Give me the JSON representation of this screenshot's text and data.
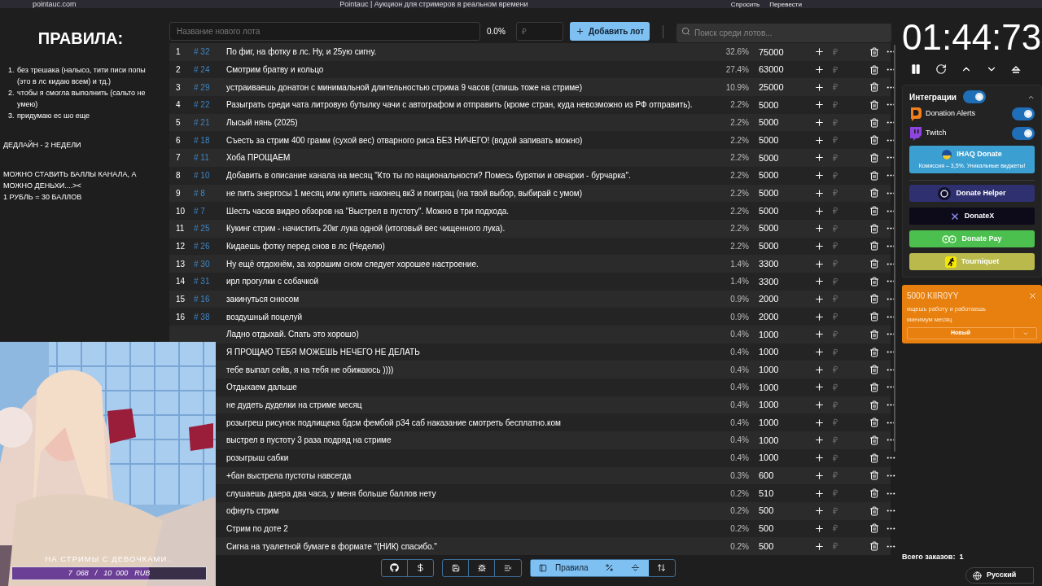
{
  "browser": {
    "url": "pointauc.com",
    "title": "Pointauc | Аукцион для стримеров в реальном времени",
    "actions": [
      "Спросить",
      "Перевести"
    ]
  },
  "rules": {
    "title": "ПРАВИЛА:",
    "items": [
      {
        "number": "1.",
        "text": "без трешака (налысо, тити писи попы (это в лс кидаю всем) и тд.)"
      },
      {
        "number": "2.",
        "text": "чтобы я смогла выполнить (сальто не умею)"
      },
      {
        "number": "3.",
        "text": "придумаю ес шо еще"
      }
    ],
    "notes": [
      "ДЕДЛАЙН - 2 НЕДЕЛИ",
      "МОЖНО СТАВИТЬ БАЛЛЫ КАНАЛА, А МОЖНО ДЕНЬХИ....><\n1 РУБЛЬ = 30 БАЛЛОВ"
    ]
  },
  "new_lot": {
    "placeholder": "Название нового лота",
    "percent": "0.0%",
    "amount_placeholder": "₽",
    "add_button": "Добавить лот"
  },
  "search": {
    "placeholder": "Поиск среди лотов..."
  },
  "lots": [
    {
      "number": "1",
      "id": "# 32",
      "text": "По фиг, на фотку в лс. Ну, и 25ую сигну.",
      "percent": "32.6%",
      "amount": "75000"
    },
    {
      "number": "2",
      "id": "# 24",
      "text": "Смотрим братву и кольцо",
      "percent": "27.4%",
      "amount": "63000"
    },
    {
      "number": "3",
      "id": "# 29",
      "text": "устраиваешь донатон с минимальной длительностью стрима 9 часов (спишь тоже на стриме)",
      "percent": "10.9%",
      "amount": "25000"
    },
    {
      "number": "4",
      "id": "# 22",
      "text": "Разыграть среди чата литровую бутылку чачи с автографом и отправить (кроме стран, куда невозможно из РФ отправить).",
      "percent": "2.2%",
      "amount": "5000"
    },
    {
      "number": "5",
      "id": "# 21",
      "text": "Лысый нянь (2025)",
      "percent": "2.2%",
      "amount": "5000"
    },
    {
      "number": "6",
      "id": "# 18",
      "text": "Съесть за стрим 400 грамм (сухой вес) отварного риса БЕЗ НИЧЕГО! (водой запивать можно)",
      "percent": "2.2%",
      "amount": "5000"
    },
    {
      "number": "7",
      "id": "# 11",
      "text": "Хоба ПРОЩАЕМ",
      "percent": "2.2%",
      "amount": "5000"
    },
    {
      "number": "8",
      "id": "# 10",
      "text": "Добавить в описание канала на месяц \"Кто ты по национальности? Помесь бурятки и овчарки - бурчарка\".",
      "percent": "2.2%",
      "amount": "5000"
    },
    {
      "number": "9",
      "id": "# 8",
      "text": "не пить энергосы 1 месяц или купить наконец вк3 и поиграц (на твой выбор, выбирай с умом)",
      "percent": "2.2%",
      "amount": "5000"
    },
    {
      "number": "10",
      "id": "# 7",
      "text": "Шесть часов видео обзоров на \"Выстрел в пустоту\". Можно в три подхода.",
      "percent": "2.2%",
      "amount": "5000"
    },
    {
      "number": "11",
      "id": "# 25",
      "text": "Кукинг стрим - начистить 20кг лука одной (итоговый вес чищенного лука).",
      "percent": "2.2%",
      "amount": "5000"
    },
    {
      "number": "12",
      "id": "# 26",
      "text": "Кидаешь фотку перед снов в лс (Неделю)",
      "percent": "2.2%",
      "amount": "5000"
    },
    {
      "number": "13",
      "id": "# 30",
      "text": "Ну ещё отдохнём, за хорошим сном следует хорошее настроение.",
      "percent": "1.4%",
      "amount": "3300"
    },
    {
      "number": "14",
      "id": "# 31",
      "text": "ирл прогулки с собачкой",
      "percent": "1.4%",
      "amount": "3300"
    },
    {
      "number": "15",
      "id": "# 16",
      "text": "закинуться снюсом",
      "percent": "0.9%",
      "amount": "2000"
    },
    {
      "number": "16",
      "id": "# 38",
      "text": "воздушный поцелуй",
      "percent": "0.9%",
      "amount": "2000"
    },
    {
      "text": "Ладно отдыхай. Спать это хорошо)",
      "percent": "0.4%",
      "amount": "1000"
    },
    {
      "text": "Я ПРОЩАЮ ТЕБЯ МОЖЕШЬ НЕЧЕГО НЕ ДЕЛАТЬ",
      "percent": "0.4%",
      "amount": "1000"
    },
    {
      "text": "тебе выпал сейв, я на тебя не обижаюсь ))))",
      "percent": "0.4%",
      "amount": "1000"
    },
    {
      "text": "Отдыхаем дальше",
      "percent": "0.4%",
      "amount": "1000"
    },
    {
      "text": "не дудеть дуделки на стриме месяц",
      "percent": "0.4%",
      "amount": "1000"
    },
    {
      "text": "розыгреш рисунок подлищека бдсм фембой р34 саб наказание смотреть бесплатно.ком",
      "percent": "0.4%",
      "amount": "1000"
    },
    {
      "text": "выстрел в пустоту 3 раза подряд на стриме",
      "percent": "0.4%",
      "amount": "1000"
    },
    {
      "text": "розыгрыш сабки",
      "percent": "0.4%",
      "amount": "1000"
    },
    {
      "text": "+бан выстрела пустоты навсегда",
      "percent": "0.3%",
      "amount": "600"
    },
    {
      "text": "слушаешь даера два часа, у меня больше баллов нету",
      "percent": "0.2%",
      "amount": "510"
    },
    {
      "text": "офнуть стрим",
      "percent": "0.2%",
      "amount": "500"
    },
    {
      "text": "Стрим по доте 2",
      "percent": "0.2%",
      "amount": "500"
    },
    {
      "text": "Сигна на туалетной бумаге в формате \"(НИК) спасибо.\"",
      "percent": "0.2%",
      "amount": "500"
    }
  ],
  "toolbar": {
    "rules_button": "Правила",
    "rules_on": true,
    "percent_on": true,
    "split_on": true,
    "sort_on": false
  },
  "timer": {
    "time": "01:44:73"
  },
  "integrations": {
    "title": "Интеграции",
    "on": true,
    "services": [
      {
        "name": "Donation Alerts",
        "kind": "alerts",
        "on": true
      },
      {
        "name": "Twitch",
        "kind": "twitch",
        "on": true
      }
    ],
    "donate_buttons": [
      {
        "name": "IHAQ Donate",
        "subtitle": "Комиссия – 3,5%. Уникальные виджеты!",
        "kind": "ihaq",
        "color": "#3c9fd2"
      },
      {
        "name": "Donate Helper",
        "kind": "helper",
        "color": "#2f3070"
      },
      {
        "name": "DonateX",
        "kind": "donatex",
        "color": "#0d0a1a"
      },
      {
        "name": "Donate Pay",
        "kind": "pay",
        "color": "#4cc04e"
      },
      {
        "name": "Tourniquet",
        "kind": "tourniquet",
        "color": "#b9b94c"
      }
    ]
  },
  "notification": {
    "title": "5000 KIIR0YY",
    "message": "ищешь работу и работаешь минимум месяц",
    "status": "Новый"
  },
  "orders": {
    "label": "Всего заказов:",
    "count": "1"
  },
  "language": "Русский",
  "stream_overlay": {
    "caption": "НА СТРИМЫ С ДЕВОЧКАМИ..",
    "goal": {
      "current": "7  068",
      "separator": "/",
      "target": "10  000",
      "currency": "RUB",
      "level": 0.7068
    }
  }
}
